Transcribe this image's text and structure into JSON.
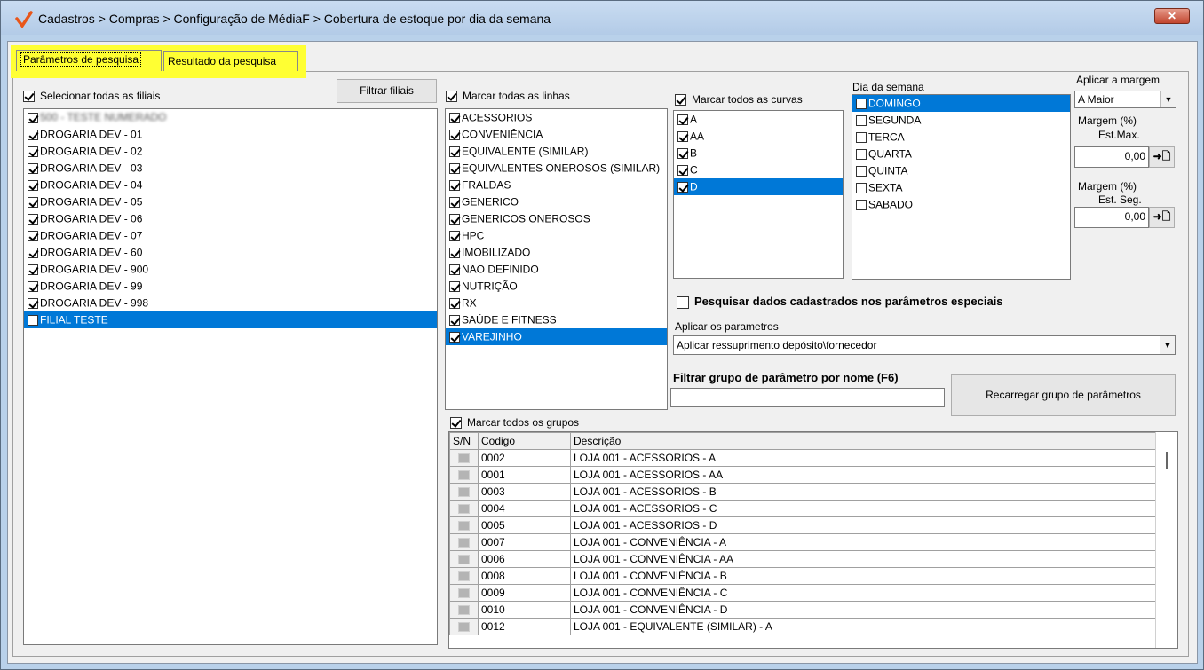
{
  "window": {
    "title": "Cadastros > Compras > Configuração de MédiaF > Cobertura de estoque por dia da semana",
    "close_label": "✕"
  },
  "tabs": [
    {
      "label": "Parâmetros de pesquisa",
      "active": true
    },
    {
      "label": "Resultado da pesquisa",
      "active": false
    }
  ],
  "filiais": {
    "select_all_label": "Selecionar todas as filiais",
    "filter_button": "Filtrar filiais",
    "items": [
      {
        "label": "500 - TESTE NUMERADO",
        "checked": true
      },
      {
        "label": "DROGARIA DEV - 01",
        "checked": true
      },
      {
        "label": "DROGARIA DEV - 02",
        "checked": true
      },
      {
        "label": "DROGARIA DEV - 03",
        "checked": true
      },
      {
        "label": "DROGARIA DEV - 04",
        "checked": true
      },
      {
        "label": "DROGARIA DEV - 05",
        "checked": true
      },
      {
        "label": "DROGARIA DEV - 06",
        "checked": true
      },
      {
        "label": "DROGARIA DEV - 07",
        "checked": true
      },
      {
        "label": "DROGARIA DEV - 60",
        "checked": true
      },
      {
        "label": "DROGARIA DEV - 900",
        "checked": true
      },
      {
        "label": "DROGARIA DEV - 99",
        "checked": true
      },
      {
        "label": "DROGARIA DEV - 998",
        "checked": true
      },
      {
        "label": "FILIAL TESTE",
        "checked": false
      }
    ]
  },
  "linhas": {
    "select_all_label": "Marcar todas as linhas",
    "items": [
      "ACESSORIOS",
      "CONVENIÊNCIA",
      "EQUIVALENTE (SIMILAR)",
      "EQUIVALENTES ONEROSOS (SIMILAR)",
      "FRALDAS",
      "GENERICO",
      "GENERICOS ONEROSOS",
      "HPC",
      "IMOBILIZADO",
      "NAO DEFINIDO",
      "NUTRIÇÃO",
      "RX",
      "SAÚDE E FITNESS",
      "VAREJINHO"
    ]
  },
  "curvas": {
    "select_all_label": "Marcar todos as curvas",
    "items": [
      "A",
      "AA",
      "B",
      "C",
      "D"
    ]
  },
  "dias": {
    "label": "Dia da semana",
    "items": [
      "DOMINGO",
      "SEGUNDA",
      "TERCA",
      "QUARTA",
      "QUINTA",
      "SEXTA",
      "SABADO"
    ]
  },
  "margem": {
    "aplicar_label": "Aplicar a margem",
    "aplicar_value": "A Maior",
    "estmax_label_1": "Margem (%)",
    "estmax_label_2": "Est.Max.",
    "estmax_value": "0,00",
    "estseg_label_1": "Margem (%)",
    "estseg_label_2": "Est. Seg.",
    "estseg_value": "0,00",
    "apply_button": "➜🗋"
  },
  "especiais": {
    "checkbox_label": "Pesquisar dados cadastrados nos parâmetros especiais",
    "aplicar_label": "Aplicar os parametros",
    "aplicar_value": "Aplicar ressuprimento depósito\\fornecedor"
  },
  "grupo": {
    "filter_label": "Filtrar grupo de parâmetro por nome (F6)",
    "filter_value": "",
    "reload_button": "Recarregar grupo de parâmetros",
    "select_all_label": "Marcar todos os grupos"
  },
  "table": {
    "headers": [
      "S/N",
      "Codigo",
      "Descrição"
    ],
    "rows": [
      [
        "0002",
        "LOJA 001 - ACESSORIOS - A"
      ],
      [
        "0001",
        "LOJA 001 - ACESSORIOS - AA"
      ],
      [
        "0003",
        "LOJA 001 - ACESSORIOS - B"
      ],
      [
        "0004",
        "LOJA 001 - ACESSORIOS - C"
      ],
      [
        "0005",
        "LOJA 001 - ACESSORIOS - D"
      ],
      [
        "0007",
        "LOJA 001 - CONVENIÊNCIA - A"
      ],
      [
        "0006",
        "LOJA 001 - CONVENIÊNCIA - AA"
      ],
      [
        "0008",
        "LOJA 001 - CONVENIÊNCIA - B"
      ],
      [
        "0009",
        "LOJA 001 - CONVENIÊNCIA - C"
      ],
      [
        "0010",
        "LOJA 001 - CONVENIÊNCIA - D"
      ],
      [
        "0012",
        "LOJA 001 - EQUIVALENTE (SIMILAR) - A"
      ]
    ]
  }
}
